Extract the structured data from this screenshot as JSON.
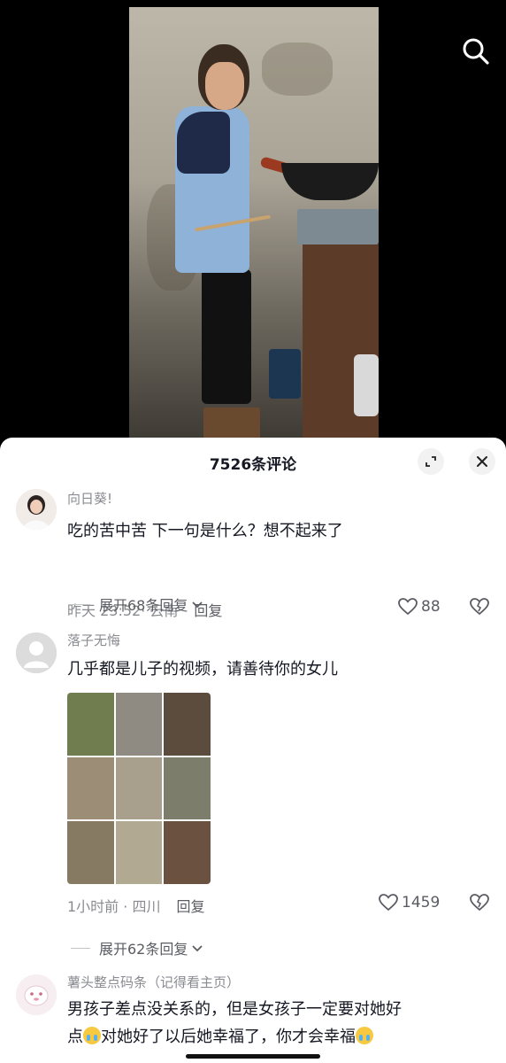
{
  "comments_panel": {
    "title": "7526条评论"
  },
  "comments": [
    {
      "username": "向日葵!",
      "text": "吃的苦中苦 下一句是什么？想不起来了",
      "time_location": "昨天 23:52· 云南",
      "reply_label": "回复",
      "likes": "88",
      "expand_label": "展开68条回复"
    },
    {
      "username": "落子无悔",
      "text": "几乎都是儿子的视频，请善待你的女儿",
      "time_location": "1小时前 · 四川",
      "reply_label": "回复",
      "likes": "1459",
      "expand_label": "展开62条回复"
    },
    {
      "username": "薯头整点码条（记得看主页）",
      "text_line1": "男孩子差点没关系的，但是女孩子一定要对她好",
      "text_line2_a": "点",
      "text_line2_b": "对她好了以后她幸福了，你才会幸福"
    }
  ],
  "colors": {
    "text_primary": "#161823",
    "text_secondary": "#8a8b91",
    "sheet_bg": "#ffffff",
    "video_bg": "#000000"
  }
}
